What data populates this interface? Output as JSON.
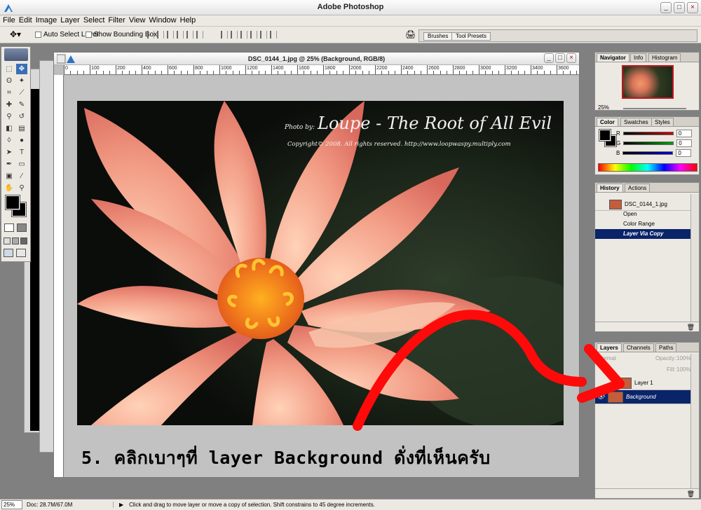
{
  "app": {
    "title": "Adobe Photoshop"
  },
  "window_buttons": {
    "minimize": "_",
    "maximize": "□",
    "close": "×"
  },
  "menu": [
    "File",
    "Edit",
    "Image",
    "Layer",
    "Select",
    "Filter",
    "View",
    "Window",
    "Help"
  ],
  "options_bar": {
    "auto_select_layer": "Auto Select Layer",
    "show_bounding_box": "Show Bounding Box",
    "palette_tabs": [
      "Brushes",
      "Tool Presets"
    ]
  },
  "document": {
    "title": "DSC_0144_1.jpg @ 25% (Background, RGB/8)",
    "ruler_marks": [
      "0",
      "100",
      "200",
      "400",
      "600",
      "800",
      "1000",
      "1200",
      "1400",
      "1600",
      "1800",
      "2000",
      "2200",
      "2400",
      "2600",
      "2800",
      "3000",
      "3200",
      "3400",
      "3600",
      "3800"
    ]
  },
  "photo": {
    "credit_small": "Photo by:",
    "credit_large": "Loupe - The Root of All Evil",
    "copyright": "Copyright© 2008. All rights reserved. http://www.loopwaspy.multiply.com"
  },
  "caption": "5. คลิกเบาๆที่ layer Background ดั่งที่เห็นครับ",
  "navigator": {
    "tabs": [
      "Navigator",
      "Info",
      "Histogram"
    ],
    "zoom": "25%"
  },
  "color_panel": {
    "tabs": [
      "Color",
      "Swatches",
      "Styles"
    ],
    "channels": [
      {
        "label": "R",
        "value": "0",
        "color": "#cc0000"
      },
      {
        "label": "G",
        "value": "0",
        "color": "#00a000"
      },
      {
        "label": "B",
        "value": "0",
        "color": "#0000cc"
      }
    ]
  },
  "history_panel": {
    "tabs": [
      "History",
      "Actions"
    ],
    "snapshot": "DSC_0144_1.jpg",
    "steps": [
      {
        "label": "Open",
        "selected": false
      },
      {
        "label": "Color Range",
        "selected": false
      },
      {
        "label": "Layer Via Copy",
        "selected": true
      }
    ]
  },
  "layers_panel": {
    "tabs": [
      "Layers",
      "Channels",
      "Paths"
    ],
    "blend_mode": "Normal",
    "opacity_label": "Opacity:",
    "opacity": "100%",
    "fill_label": "Fill:",
    "fill": "100%",
    "layers": [
      {
        "name": "Layer 1",
        "selected": false,
        "visible": false
      },
      {
        "name": "Background",
        "selected": true,
        "visible": true
      }
    ]
  },
  "status": {
    "zoom": "25%",
    "doc": "Doc: 28.7M/67.0M",
    "hint": "Click and drag to move layer or move a copy of selection. Shift constrains to 45 degree increments."
  },
  "colors": {
    "annotation_arrow": "#ff0a0a",
    "selection": "#0a246a",
    "accent": "#3a6fb8"
  },
  "icons": [
    "photoshop-logo",
    "move-tool",
    "marquee-tool",
    "lasso-tool",
    "crop-tool",
    "brush-tool",
    "eraser-tool",
    "text-tool",
    "eye-icon",
    "brush-link-icon",
    "trash-icon"
  ]
}
